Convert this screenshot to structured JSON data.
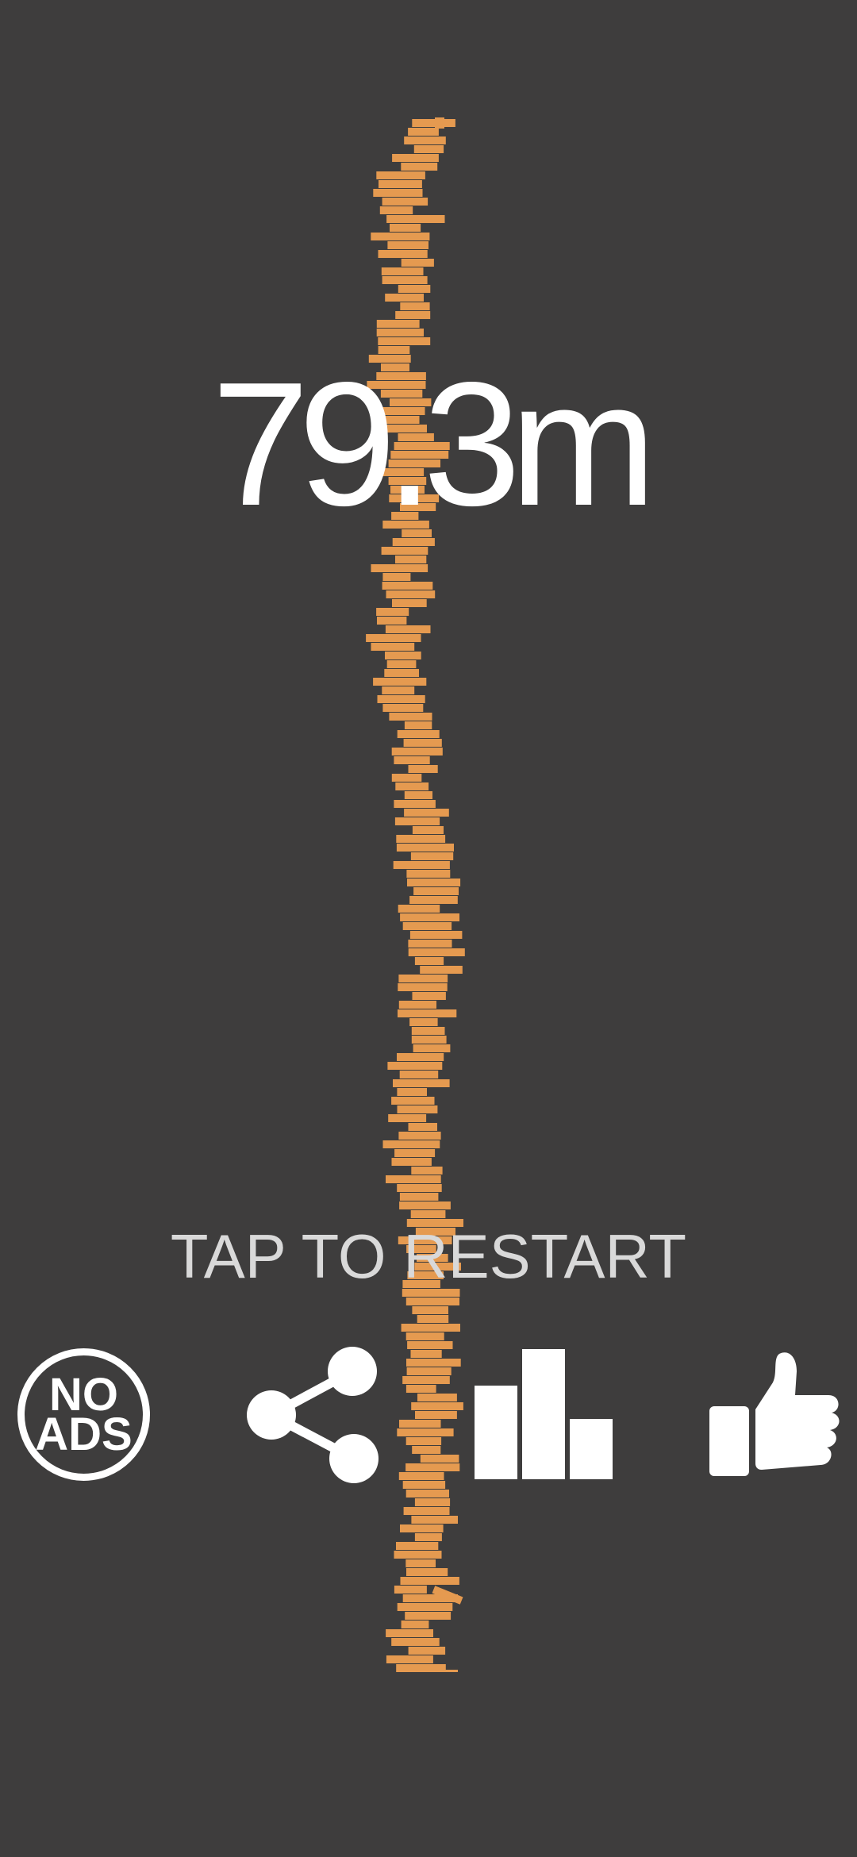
{
  "game": {
    "score": "79.3m",
    "restart_label": "TAP TO RESTART"
  },
  "buttons": {
    "no_ads": {
      "line1": "NO",
      "line2": "ADS",
      "icon": "no-ads-icon"
    },
    "share": {
      "icon": "share-icon"
    },
    "leaderboard": {
      "icon": "bar-chart-icon"
    },
    "like": {
      "icon": "thumbs-up-icon"
    }
  },
  "colors": {
    "background": "#3e3d3d",
    "block": "#e59a50",
    "text": "#ffffff",
    "restart_text": "#d9d9d9"
  }
}
